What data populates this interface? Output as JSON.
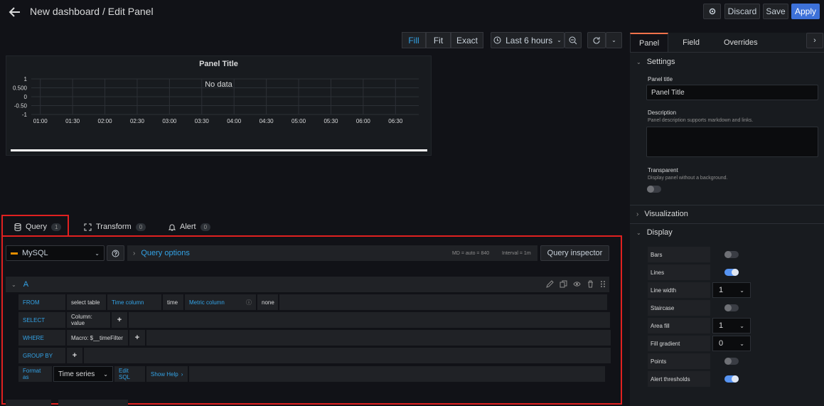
{
  "header": {
    "title": "New dashboard / Edit Panel",
    "discard": "Discard",
    "save": "Save",
    "apply": "Apply"
  },
  "timebar": {
    "fill": "Fill",
    "fit": "Fit",
    "exact": "Exact",
    "range": "Last 6 hours"
  },
  "panel": {
    "title": "Panel Title",
    "no_data": "No data",
    "y_ticks": [
      "1",
      "0.500",
      "0",
      "-0.50",
      "-1"
    ],
    "x_ticks": [
      "01:00",
      "01:30",
      "02:00",
      "02:30",
      "03:00",
      "03:30",
      "04:00",
      "04:30",
      "05:00",
      "05:30",
      "06:00",
      "06:30"
    ]
  },
  "tabs": {
    "query": "Query",
    "query_count": "1",
    "transform": "Transform",
    "transform_count": "0",
    "alert": "Alert",
    "alert_count": "0"
  },
  "query": {
    "datasource": "MySQL",
    "options": "Query options",
    "md": "MD = auto = 840",
    "interval": "Interval = 1m",
    "inspector": "Query inspector",
    "ref": "A",
    "from_kw": "FROM",
    "from_table": "select table",
    "time_col": "Time column",
    "time_val": "time",
    "metric_col": "Metric column",
    "metric_val": "none",
    "select_kw": "SELECT",
    "select_val": "Column: value",
    "where_kw": "WHERE",
    "where_val": "Macro: $__timeFilter",
    "group_kw": "GROUP BY",
    "format_kw": "Format as",
    "format_val": "Time series",
    "edit_sql": "Edit SQL",
    "show_help": "Show Help",
    "plus": "+"
  },
  "sidebar": {
    "tab_panel": "Panel",
    "tab_field": "Field",
    "tab_overrides": "Overrides",
    "settings": "Settings",
    "panel_title_label": "Panel title",
    "panel_title_value": "Panel Title",
    "description_label": "Description",
    "description_hint": "Panel description supports markdown and links.",
    "transparent_label": "Transparent",
    "transparent_hint": "Display panel without a background.",
    "visualization": "Visualization",
    "display": "Display",
    "bars": "Bars",
    "lines": "Lines",
    "line_width": "Line width",
    "line_width_val": "1",
    "staircase": "Staircase",
    "area_fill": "Area fill",
    "area_fill_val": "1",
    "fill_gradient": "Fill gradient",
    "fill_gradient_val": "0",
    "points": "Points",
    "alert_thresholds": "Alert thresholds",
    "toggles": {
      "bars": false,
      "lines": true,
      "staircase": false,
      "points": false,
      "alert_thresholds": true,
      "transparent": false
    }
  },
  "colors": {
    "accent": "#33a2e5",
    "apply": "#3d71d9",
    "highlight": "#e02020",
    "tab_active": "#f2724b"
  }
}
